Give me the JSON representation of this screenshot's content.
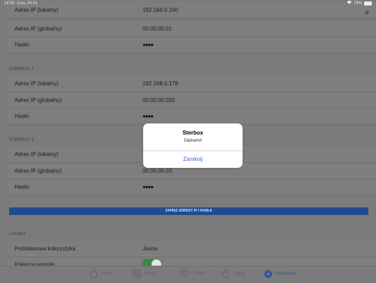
{
  "status_bar": {
    "time": "14:50",
    "date": "Czw. 24.01",
    "battery": "74%"
  },
  "rows": {
    "sb1_local": {
      "label": "Adres IP (lokalny)",
      "value": "192.168.0.160"
    },
    "sb1_global": {
      "label": "Adres IP (globalny)",
      "value": "00.00.00.01"
    },
    "sb1_pass": {
      "label": "Hasło",
      "value": "●●●●"
    },
    "sb2_local": {
      "label": "Adres IP (lokalny)",
      "value": "192.168.0.178"
    },
    "sb2_global": {
      "label": "Adres IP (globalny)",
      "value": "00.00.00.020"
    },
    "sb2_pass": {
      "label": "Hasło",
      "value": "●●●●"
    },
    "sb3_local": {
      "label": "Adres IP (lokalny)",
      "value": ""
    },
    "sb3_global": {
      "label": "Adres IP (globalny)",
      "value": "00.00.00.03"
    },
    "sb3_pass": {
      "label": "Hasło",
      "value": "●●●●"
    },
    "layout_color": {
      "label": "Podstawowa kolorystyka",
      "value": "Jasna"
    },
    "layout_weather": {
      "label": "Pokazuj pogodę",
      "value": ""
    }
  },
  "sections": {
    "sterbox2": "STERBOX 2",
    "sterbox3": "STERBOX 3",
    "layout": "LAYOUT"
  },
  "save_button": "ZAPISZ ADRESY IP I HASŁA",
  "dialog": {
    "title": "Sterbox",
    "message": "Zapisano!",
    "button": "Zamknij"
  },
  "tabs": [
    {
      "label": "Home",
      "icon": "home-icon"
    },
    {
      "label": "Pokoje",
      "icon": "grid-icon"
    },
    {
      "label": "Sceny",
      "icon": "eye-icon"
    },
    {
      "label": "Zegary",
      "icon": "clock-icon"
    },
    {
      "label": "Ustawienia",
      "icon": "gear-icon",
      "active": true
    }
  ],
  "colors": {
    "accent": "#2a57a0",
    "save_button": "#1f4c8f",
    "toggle_on": "#3a8a3a",
    "dialog_button": "#2f6bd6"
  }
}
